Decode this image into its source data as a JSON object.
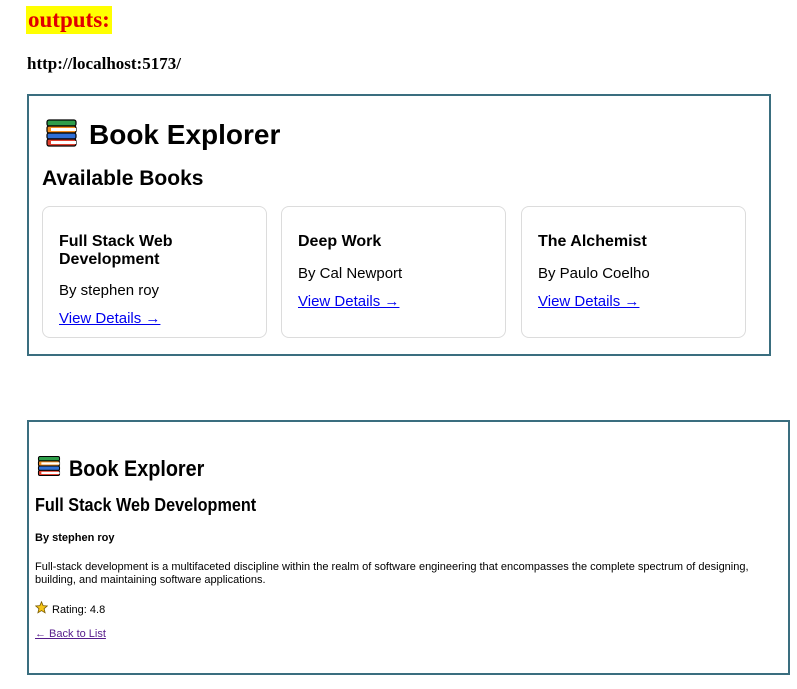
{
  "label": "outputs:",
  "url": "http://localhost:5173/",
  "app": {
    "brand": "Book Explorer"
  },
  "list_view": {
    "heading": "Available Books",
    "books": [
      {
        "title": "Full Stack Web Development",
        "author": "By stephen roy",
        "link": "View Details →"
      },
      {
        "title": "Deep Work",
        "author": "By Cal Newport",
        "link": "View Details →"
      },
      {
        "title": "The Alchemist",
        "author": "By Paulo Coelho",
        "link": "View Details →"
      }
    ]
  },
  "detail_view": {
    "title": "Full Stack Web Development",
    "author": "By stephen roy",
    "description": "Full-stack development is a multifaceted discipline within the realm of software engineering that encompasses the complete spectrum of designing, building, and maintaining software applications.",
    "rating": "Rating: 4.8",
    "back": "← Back to List"
  },
  "icons": {
    "brand": "books-icon",
    "rating": "star-icon"
  },
  "colors": {
    "highlight_bg": "#ffff00",
    "highlight_text": "#e00000",
    "frame_border": "#3a6e7f",
    "link": "#0000ee",
    "visited_link": "#551a8b"
  }
}
